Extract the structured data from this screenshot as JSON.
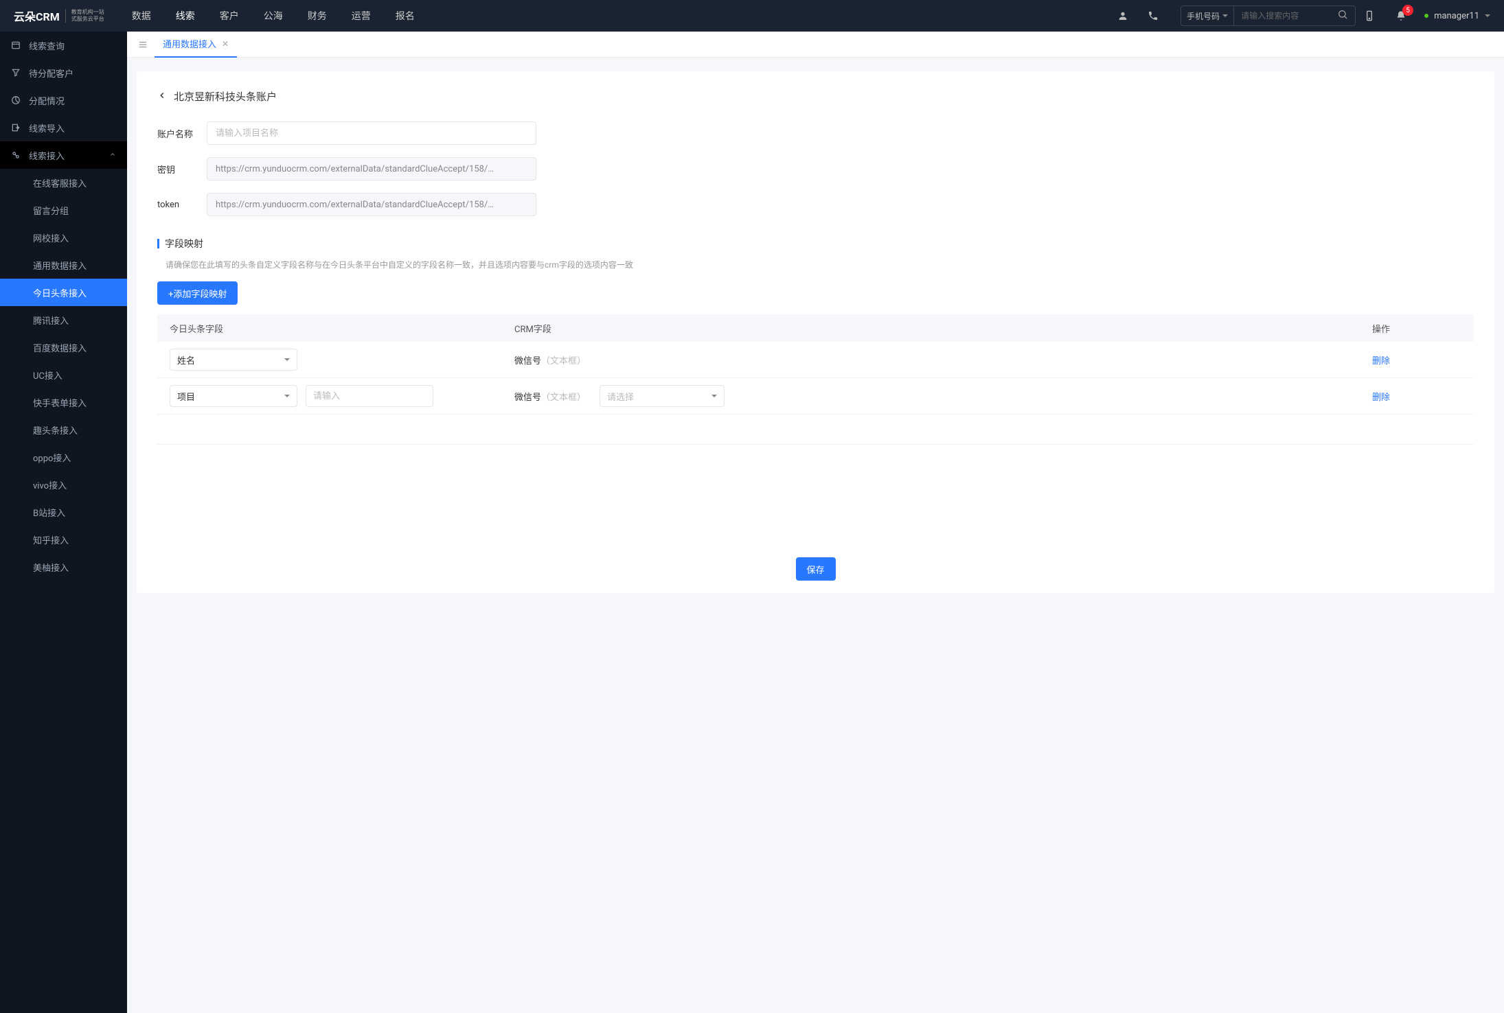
{
  "header": {
    "logo_main": "云朵CRM",
    "logo_sub1": "教育机构一站",
    "logo_sub2": "式服务云平台",
    "nav": [
      "数据",
      "线索",
      "客户",
      "公海",
      "财务",
      "运营",
      "报名"
    ],
    "active_nav": 1,
    "search_type": "手机号码",
    "search_placeholder": "请输入搜索内容",
    "notif_count": "5",
    "user": "manager11"
  },
  "sidebar": {
    "items": [
      {
        "label": "线索查询",
        "icon": "list"
      },
      {
        "label": "待分配客户",
        "icon": "filter"
      },
      {
        "label": "分配情况",
        "icon": "pie"
      },
      {
        "label": "线索导入",
        "icon": "export"
      },
      {
        "label": "线索接入",
        "icon": "plug",
        "expanded": true,
        "children": [
          {
            "label": "在线客服接入"
          },
          {
            "label": "留言分组"
          },
          {
            "label": "网校接入"
          },
          {
            "label": "通用数据接入"
          },
          {
            "label": "今日头条接入",
            "active": true
          },
          {
            "label": "腾讯接入"
          },
          {
            "label": "百度数据接入"
          },
          {
            "label": "UC接入"
          },
          {
            "label": "快手表单接入"
          },
          {
            "label": "趣头条接入"
          },
          {
            "label": "oppo接入"
          },
          {
            "label": "vivo接入"
          },
          {
            "label": "B站接入"
          },
          {
            "label": "知乎接入"
          },
          {
            "label": "美柚接入"
          }
        ]
      }
    ]
  },
  "tabs": {
    "active_label": "通用数据接入"
  },
  "page": {
    "title": "北京昱新科技头条账户",
    "form": {
      "name_label": "账户名称",
      "name_placeholder": "请输入项目名称",
      "secret_label": "密钥",
      "secret_value": "https://crm.yunduocrm.com/externalData/standardClueAccept/158/…",
      "token_label": "token",
      "token_value": "https://crm.yunduocrm.com/externalData/standardClueAccept/158/…"
    },
    "section_title": "字段映射",
    "section_hint": "请确保您在此填写的头条自定义字段名称与在今日头条平台中自定义的字段名称一致，并且选项内容要与crm字段的选项内容一致",
    "add_btn": "+添加字段映射",
    "table": {
      "headers": [
        "今日头条字段",
        "CRM字段",
        "操作"
      ],
      "rows": [
        {
          "field": "姓名",
          "crm_label": "微信号",
          "crm_hint": "（文本框）",
          "del": "删除"
        },
        {
          "field": "项目",
          "extra_placeholder": "请输入",
          "crm_label": "微信号",
          "crm_hint": "（文本框）",
          "sel_placeholder": "请选择",
          "del": "删除"
        }
      ]
    },
    "save_btn": "保存"
  }
}
